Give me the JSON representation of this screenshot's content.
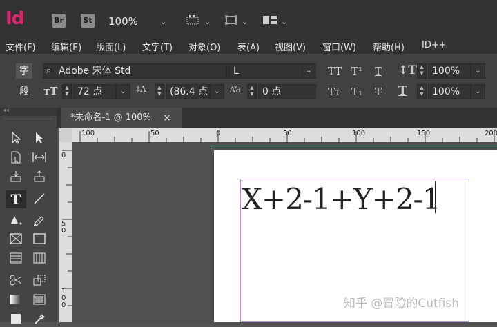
{
  "app": {
    "logo": "Id",
    "bridge_badge": "Br",
    "stock_badge": "St",
    "zoom_level": "100%"
  },
  "menu": [
    "文件(F)",
    "编辑(E)",
    "版面(L)",
    "文字(T)",
    "对象(O)",
    "表(A)",
    "视图(V)",
    "窗口(W)",
    "帮助(H)",
    "ID++"
  ],
  "control": {
    "char_mode": "字",
    "para_mode": "段",
    "font_family": "Adobe 宋体 Std",
    "font_style": "L",
    "font_size": "72 点",
    "leading": "(86.4 点",
    "tracking": "0 点",
    "vertical_scale": "100%",
    "horizontal_scale": "100%",
    "tt_allcaps": "TT",
    "t_super": "T¹",
    "t_under": "T",
    "t_smallcaps": "Tт",
    "t_sub": "T₁",
    "t_strike": "T"
  },
  "tab": {
    "title": "*未命名-1 @ 100%",
    "close": "×"
  },
  "panel": {
    "collapse": "‹‹"
  },
  "rulers": {
    "h": [
      "100",
      "50",
      "0",
      "50",
      "100",
      "150",
      "200"
    ],
    "v": [
      "0",
      "5\n0",
      "1\n0\n0"
    ]
  },
  "document": {
    "frame_text": "X+2-1+Y+2-1"
  },
  "watermark": "知乎 @冒险的Cutfish"
}
